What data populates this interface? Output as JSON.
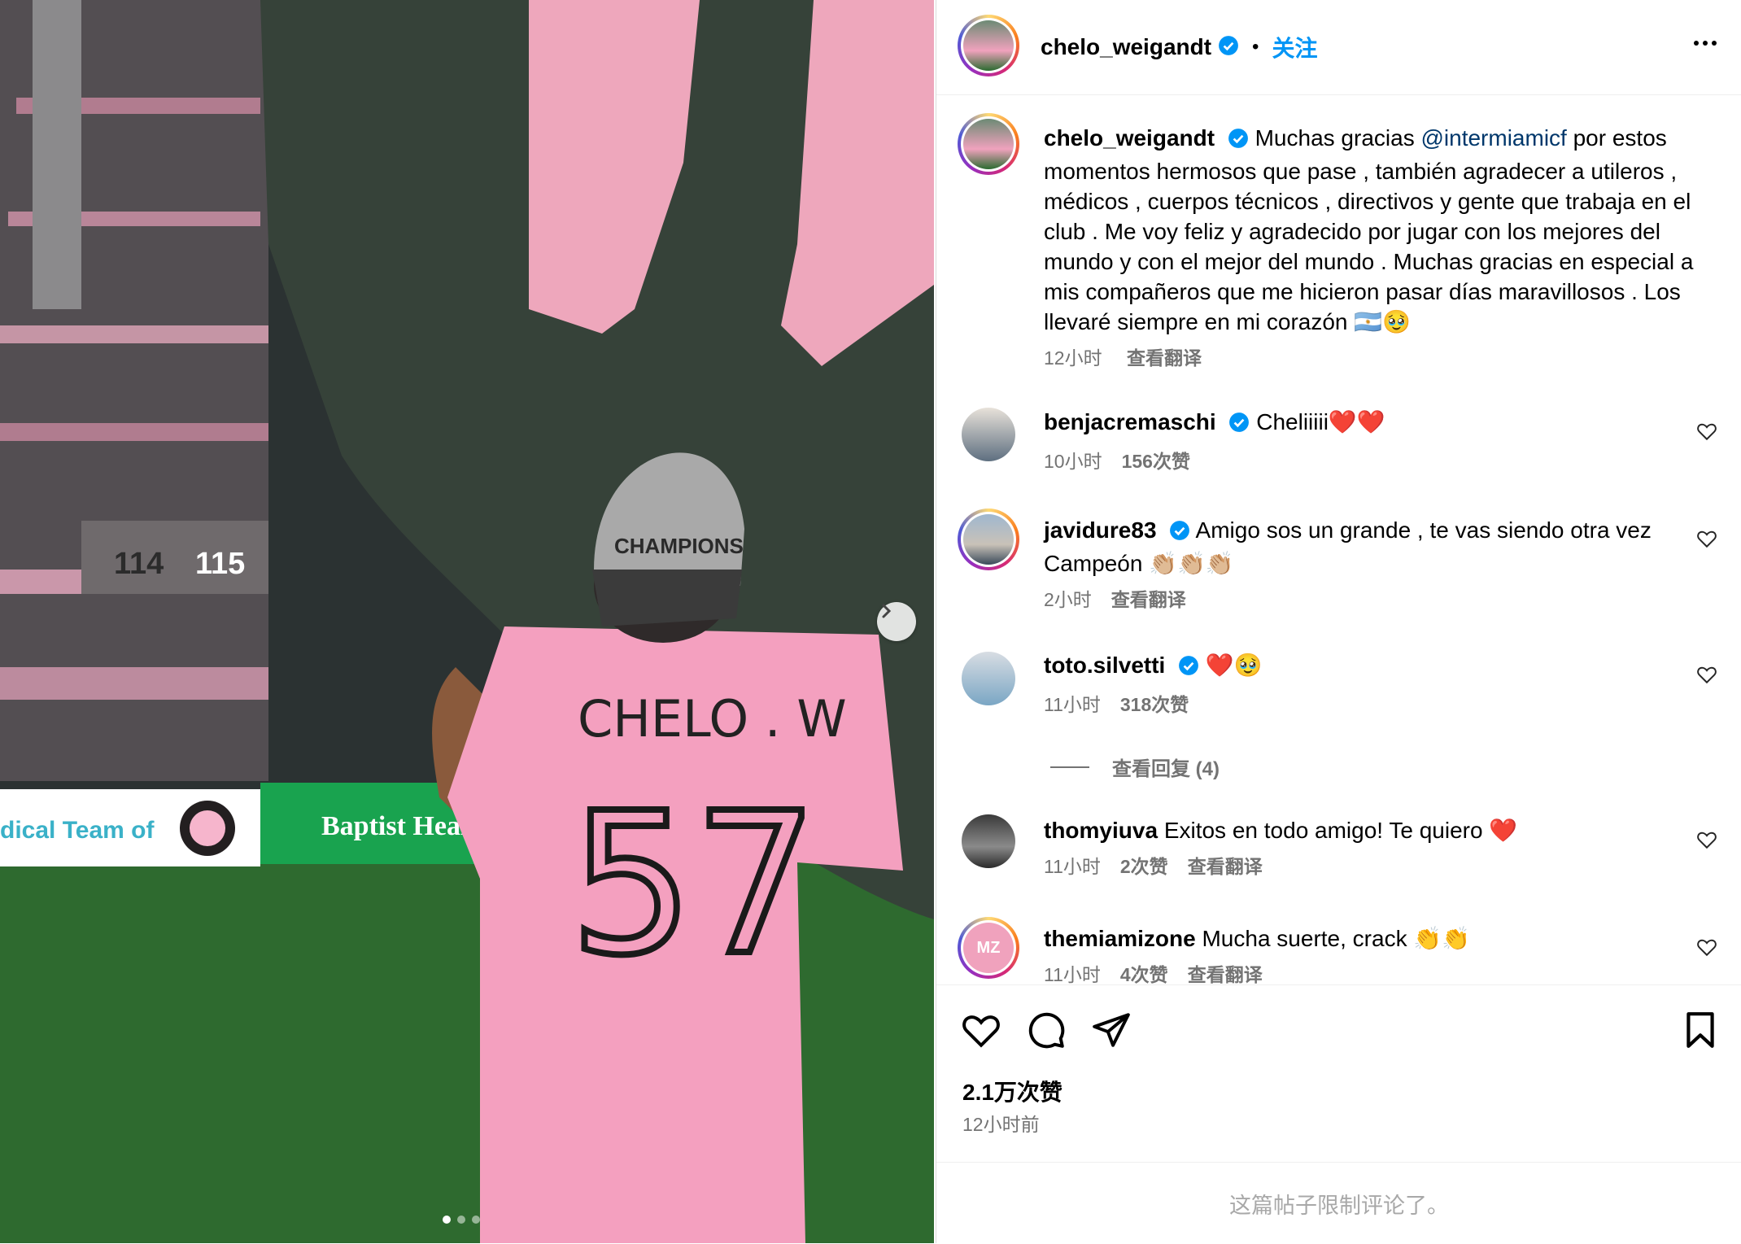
{
  "post": {
    "author": "chelo_weigandt",
    "follow_label": "关注",
    "caption_mention": "@intermiamicf",
    "caption_before": "Muchas gracias ",
    "caption_after": " por estos momentos hermosos que pase , también agradecer a utileros , médicos , cuerpos técnicos , directivos y gente que trabaja en el club . Me voy feliz y agradecido por jugar con los mejores del mundo y con el mejor del mundo . Muchas gracias en especial a mis compañeros que me hicieron pasar días maravillosos . Los llevaré siempre en mi corazón 🇦🇷🥹",
    "caption_time": "12小时",
    "caption_translate": "查看翻译",
    "likes": "2.1万次赞",
    "posted": "12小时前",
    "comments_limited": "这篇帖子限制评论了。"
  },
  "photo": {
    "jersey_name": "CHELO . W",
    "jersey_number": "57",
    "cap_text": "CHAMPIONS",
    "stand_numbers": [
      "114",
      "115"
    ],
    "banner_text": "Baptist Health",
    "board_text": "dical Team of"
  },
  "comments": [
    {
      "user": "benjacremaschi",
      "verified": true,
      "text": "Cheliiiii❤️❤️",
      "time": "10小时",
      "likes": "156次赞",
      "translate": ""
    },
    {
      "user": "javidure83",
      "verified": true,
      "text": "Amigo sos un grande , te vas siendo otra vez Campeón 👏🏼👏🏼👏🏼",
      "time": "2小时",
      "likes": "",
      "translate": "查看翻译"
    },
    {
      "user": "toto.silvetti",
      "verified": true,
      "text": "❤️🥹",
      "time": "11小时",
      "likes": "318次赞",
      "translate": "",
      "replies": "查看回复 (4)"
    },
    {
      "user": "thomyiuva",
      "verified": false,
      "text": "Exitos en todo amigo! Te quiero ❤️",
      "time": "11小时",
      "likes": "2次赞",
      "translate": "查看翻译"
    },
    {
      "user": "themiamizone",
      "verified": false,
      "text": "Mucha suerte, crack 👏👏",
      "time": "11小时",
      "likes": "4次赞",
      "translate": "查看翻译"
    }
  ],
  "colors": {
    "accent": "#0095f6",
    "mention": "#00376b",
    "muted": "#737373",
    "jersey_pink": "#f4a0bf"
  }
}
